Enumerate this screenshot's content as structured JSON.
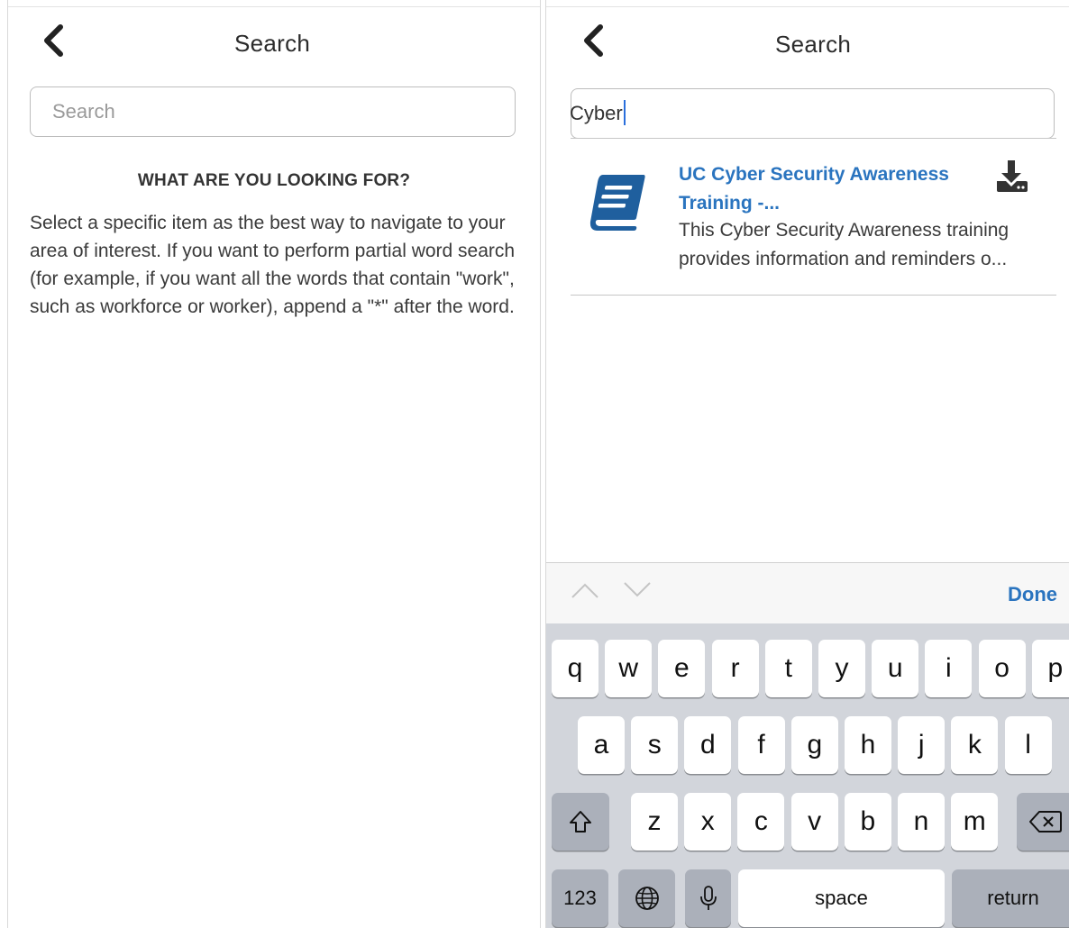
{
  "left_screen": {
    "title": "Search",
    "search_placeholder": "Search",
    "heading": "WHAT ARE YOU LOOKING FOR?",
    "help_text": "Select a specific item as the best way to navigate to your area of interest. If you want to perform partial word search (for example, if you want all the words that contain \"work\", such as workforce or worker), append a \"*\" after the word."
  },
  "right_screen": {
    "title": "Search",
    "search_value": "Cyber",
    "result": {
      "title": "UC Cyber Security Awareness Training -...",
      "description": "This Cyber Security Awareness training provides information and reminders o...",
      "icon": "book-icon",
      "action_icon": "download-icon"
    },
    "accessory": {
      "done_label": "Done"
    },
    "keyboard": {
      "row1": [
        "q",
        "w",
        "e",
        "r",
        "t",
        "y",
        "u",
        "i",
        "o",
        "p"
      ],
      "row2": [
        "a",
        "s",
        "d",
        "f",
        "g",
        "h",
        "j",
        "k",
        "l"
      ],
      "row3": [
        "z",
        "x",
        "c",
        "v",
        "b",
        "n",
        "m"
      ],
      "numbers_label": "123",
      "space_label": "space",
      "return_label": "return"
    }
  },
  "colors": {
    "accent": "#2a74bf",
    "icon_blue": "#1f5f9e",
    "caret": "#2a6fdc"
  }
}
